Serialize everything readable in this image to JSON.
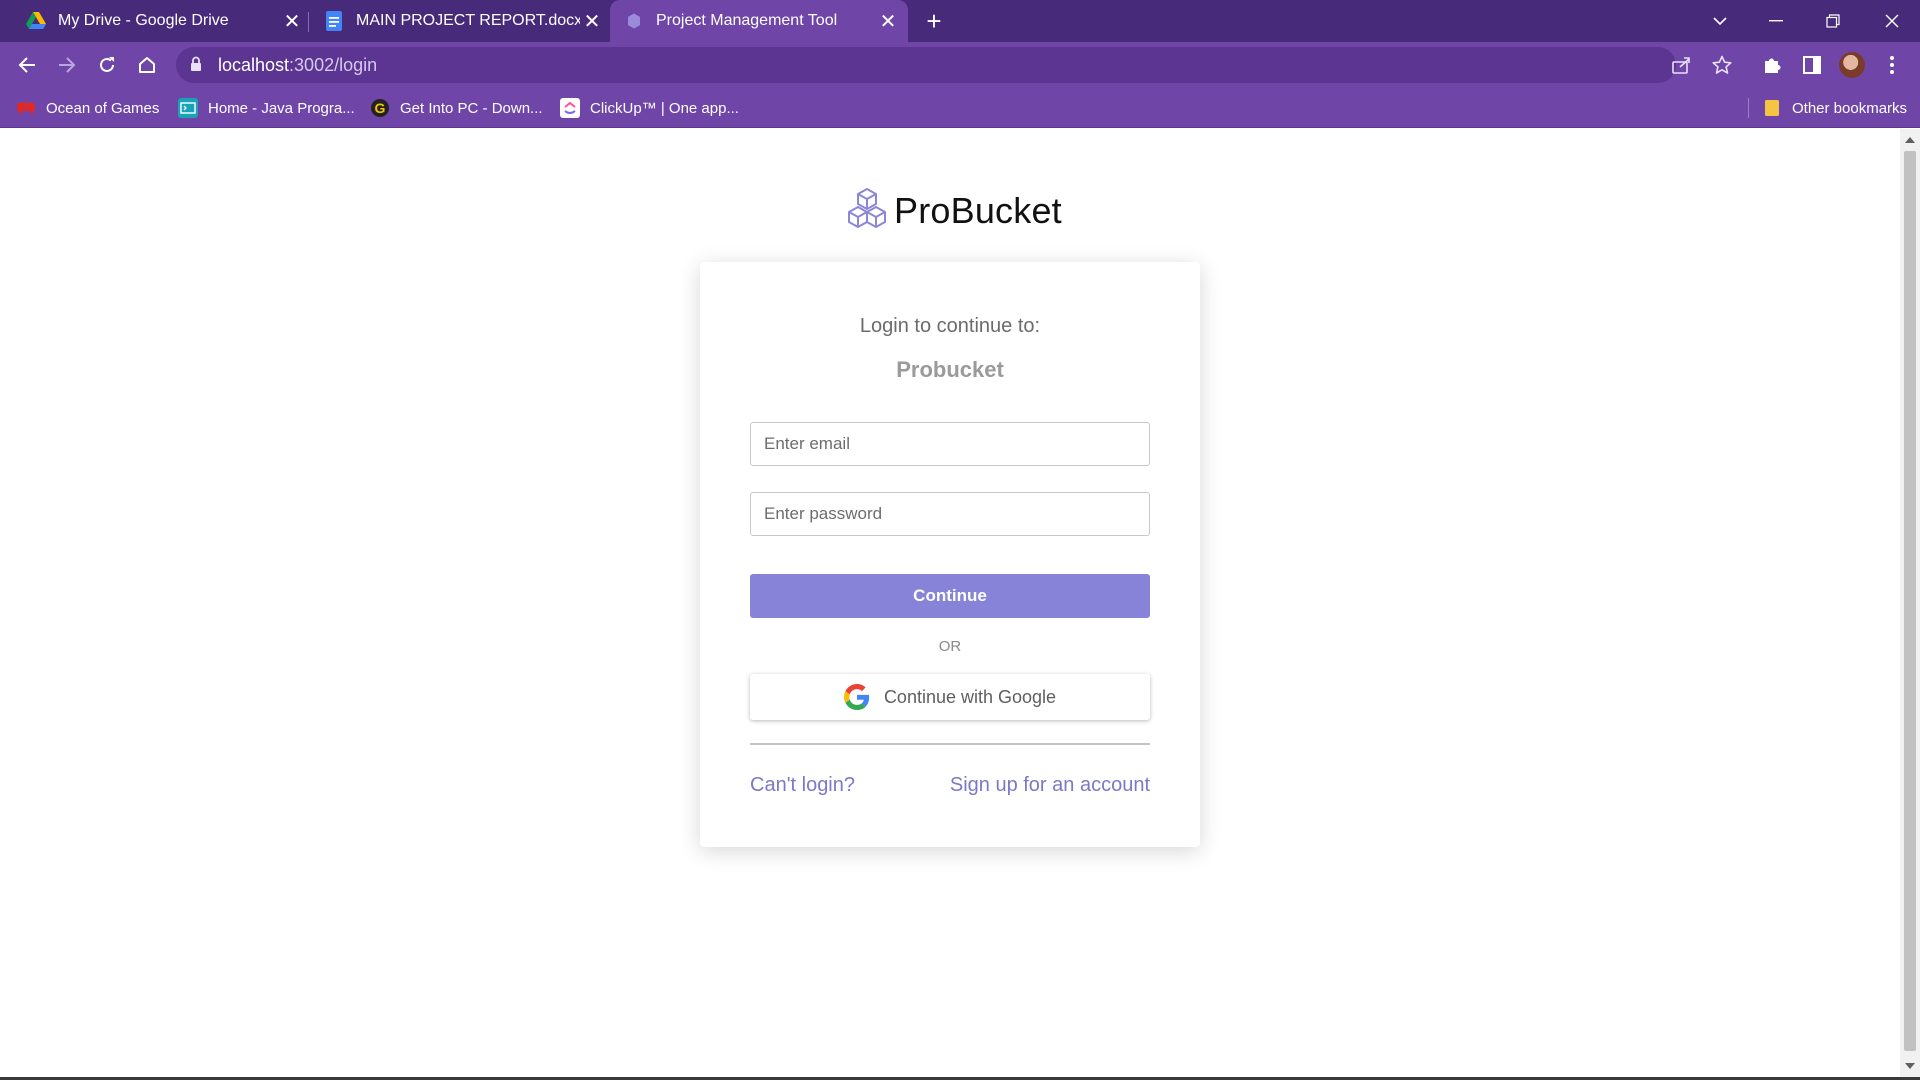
{
  "browser": {
    "tabs": [
      {
        "title": "My Drive - Google Drive",
        "icon": "google-drive-icon"
      },
      {
        "title": "MAIN PROJECT REPORT.docx - G",
        "icon": "google-docs-icon"
      },
      {
        "title": "Project Management Tool",
        "icon": "probucket-favicon",
        "active": true
      }
    ],
    "url_host": "localhost",
    "url_path": ":3002/login",
    "bookmarks": [
      {
        "label": "Ocean of Games",
        "icon": "gamepad-icon"
      },
      {
        "label": "Home - Java Progra...",
        "icon": "java-site-icon"
      },
      {
        "label": "Get Into PC - Down...",
        "icon": "getintopc-icon"
      },
      {
        "label": "ClickUp™ | One app...",
        "icon": "clickup-icon"
      }
    ],
    "other_bookmarks": "Other bookmarks",
    "colors": {
      "tabbar": "#482a7a",
      "toolbar": "#6f45a8"
    }
  },
  "page": {
    "brand": "ProBucket",
    "login_prompt": "Login to continue to:",
    "app_name": "Probucket",
    "email_placeholder": "Enter email",
    "password_placeholder": "Enter password",
    "continue_label": "Continue",
    "or_label": "OR",
    "google_label": "Continue with Google",
    "cant_login": "Can't login?",
    "signup": "Sign up for an account",
    "colors": {
      "primary": "#8683d8",
      "link": "#7b78c8"
    }
  }
}
